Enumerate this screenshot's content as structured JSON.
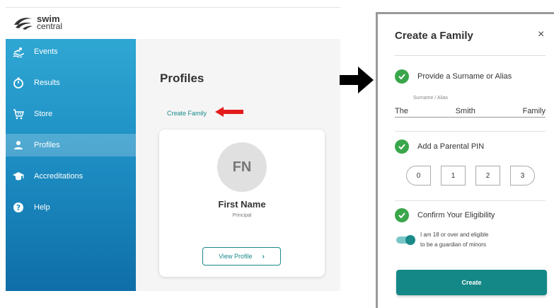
{
  "app": {
    "logo": {
      "line1": "swim",
      "line2": "central"
    },
    "sidebar": {
      "items": [
        {
          "label": "Events",
          "icon": "swimmer-icon",
          "active": false
        },
        {
          "label": "Results",
          "icon": "stopwatch-icon",
          "active": false
        },
        {
          "label": "Store",
          "icon": "cart-icon",
          "active": false
        },
        {
          "label": "Profiles",
          "icon": "person-icon",
          "active": true
        },
        {
          "label": "Accreditations",
          "icon": "graduation-cap-icon",
          "active": false
        },
        {
          "label": "Help",
          "icon": "help-icon",
          "active": false
        }
      ]
    },
    "main": {
      "title": "Profiles",
      "create_family_link": "Create Family",
      "profile_card": {
        "initials": "FN",
        "name": "First Name",
        "role": "Principal",
        "view_button": "View Profile",
        "view_button_icon": "chevron-right-icon"
      }
    }
  },
  "modal": {
    "title": "Create a Family",
    "close_glyph": "×",
    "step1": {
      "label": "Provide a Surname or Alias",
      "field_label": "Surname / Alias",
      "value_parts": [
        "The",
        "Smith",
        "Family"
      ]
    },
    "step2": {
      "label": "Add a Parental PIN",
      "pin": [
        "0",
        "1",
        "2",
        "3"
      ]
    },
    "step3": {
      "label": "Confirm Your Eligibility",
      "toggle_on": true,
      "eligibility_line1": "I am 18 or over and eligible",
      "eligibility_line2": "to be a guardian of minors"
    },
    "create_button": "Create"
  },
  "colors": {
    "teal": "#138886",
    "check_green": "#3aa64a",
    "sidebar_top": "#2fa7d3",
    "sidebar_bottom": "#0f6ea8",
    "annotation_red": "#e41b1b"
  }
}
